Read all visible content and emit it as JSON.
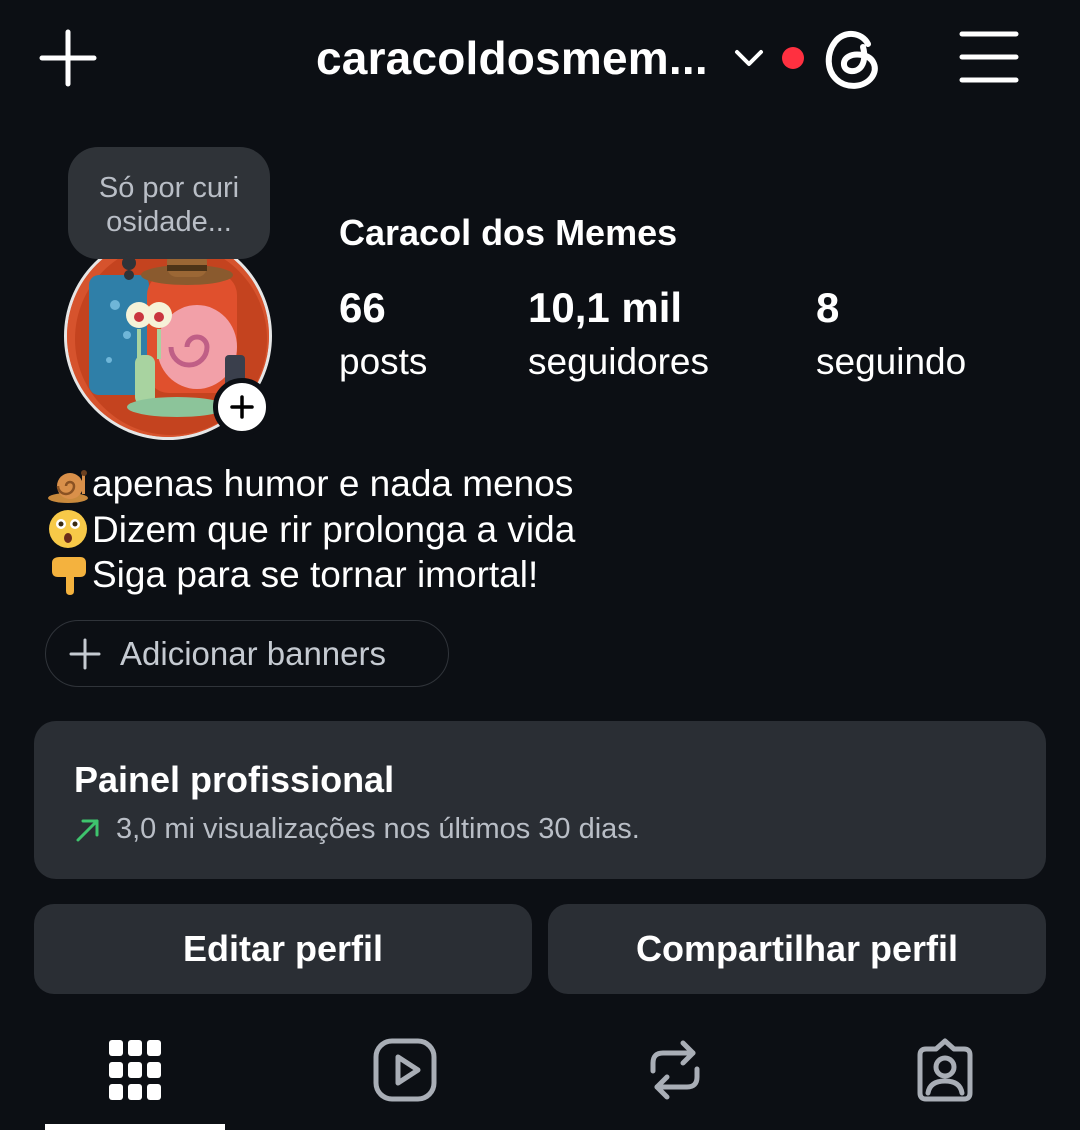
{
  "header": {
    "username": "caracoldosmem...",
    "icons": {
      "add": "plus-icon",
      "switch": "chevron-down-icon",
      "notification": "notification-dot",
      "threads": "threads-icon",
      "menu": "hamburger-menu-icon"
    },
    "notification_color": "#ff3040"
  },
  "note": {
    "text": "Só por curi osidade..."
  },
  "profile": {
    "display_name": "Caracol dos Memes",
    "stats": [
      {
        "value": "66",
        "label": "posts"
      },
      {
        "value": "10,1 mil",
        "label": "seguidores"
      },
      {
        "value": "8",
        "label": "seguindo"
      }
    ],
    "bio": [
      {
        "emoji": "snail-emoji",
        "text": "apenas humor e nada menos"
      },
      {
        "emoji": "astonished-face-emoji",
        "text": "Dizem que rir prolonga a vida"
      },
      {
        "emoji": "backhand-index-pointing-down-emoji",
        "text": "Siga para se tornar imortal!"
      }
    ]
  },
  "banners": {
    "label": "Adicionar banners"
  },
  "dashboard": {
    "title": "Painel profissional",
    "subtitle": "3,0 mi visualizações nos últimos 30 dias.",
    "trend_color": "#3ec46d"
  },
  "actions": {
    "edit": "Editar perfil",
    "share": "Compartilhar perfil"
  },
  "tabs": [
    {
      "icon": "grid-icon",
      "active": true
    },
    {
      "icon": "reels-icon",
      "active": false
    },
    {
      "icon": "reposts-icon",
      "active": false
    },
    {
      "icon": "tagged-icon",
      "active": false
    }
  ],
  "colors": {
    "background": "#0c0f14",
    "card": "#2a2e34",
    "text": "#ffffff",
    "muted": "#b9bec6"
  }
}
